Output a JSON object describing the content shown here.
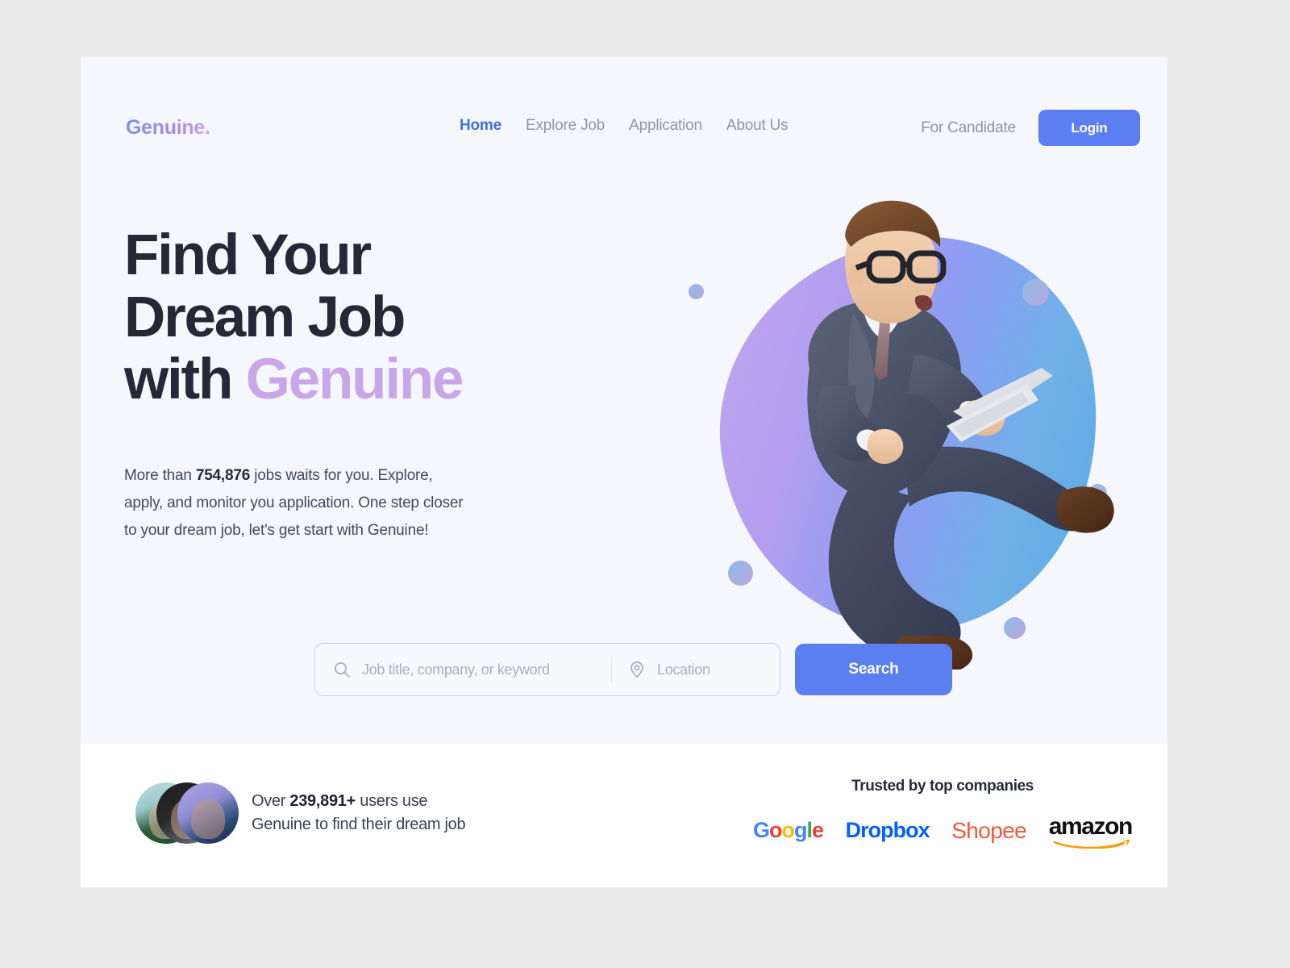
{
  "page": {
    "background_color": "#e9e9e9",
    "canvas_color": "#ffffff",
    "hero_background_color": "#f6f7fc"
  },
  "header": {
    "logo": "Genuine.",
    "nav": [
      {
        "label": "Home",
        "active": true
      },
      {
        "label": "Explore Job",
        "active": false
      },
      {
        "label": "Application",
        "active": false
      },
      {
        "label": "About Us",
        "active": false
      }
    ],
    "for_candidate_label": "For Candidate",
    "login_label": "Login",
    "accent_color": "#5b7ef0",
    "active_nav_color": "#3f6fe8",
    "nav_color": "#9095a3"
  },
  "hero": {
    "headline_line1": "Find Your",
    "headline_line2": "Dream Job",
    "headline_line3_prefix": "with ",
    "headline_line3_accent": "Genuine",
    "headline_color": "#252836",
    "headline_accent_color": "#c9a6e8",
    "subcopy_prefix": "More than ",
    "subcopy_count": "754,876",
    "subcopy_rest": " jobs waits for you. Explore, apply, and monitor you application. One step closer to your dream job, let's get start with Genuine!"
  },
  "illustration": {
    "name": "businessman-with-laptop-3d",
    "blob_gradient_from": "#c3a6ee",
    "blob_gradient_to": "#56a9e2",
    "decorative_dots": 5
  },
  "search": {
    "job_placeholder": "Job title, company, or keyword",
    "job_value": "",
    "location_placeholder": "Location",
    "location_value": "",
    "button_label": "Search",
    "search_icon": "search-icon",
    "location_icon": "location-pin-icon",
    "button_color": "#5b7ef0"
  },
  "social_proof": {
    "prefix": "Over ",
    "count": "239,891+",
    "suffix": " users use",
    "line2": "Genuine to find their dream job",
    "avatar_count": 3
  },
  "trusted": {
    "title": "Trusted by top companies",
    "companies": [
      {
        "name": "Google",
        "colors": [
          "#4285f4",
          "#ea4335",
          "#fbbc05",
          "#4285f4",
          "#34a853",
          "#ea4335"
        ]
      },
      {
        "name": "Dropbox",
        "color": "#0061fe"
      },
      {
        "name": "Shopee",
        "color": "#ee5a3a"
      },
      {
        "name": "amazon",
        "color": "#111111",
        "swoosh_color": "#ff9900"
      }
    ]
  }
}
